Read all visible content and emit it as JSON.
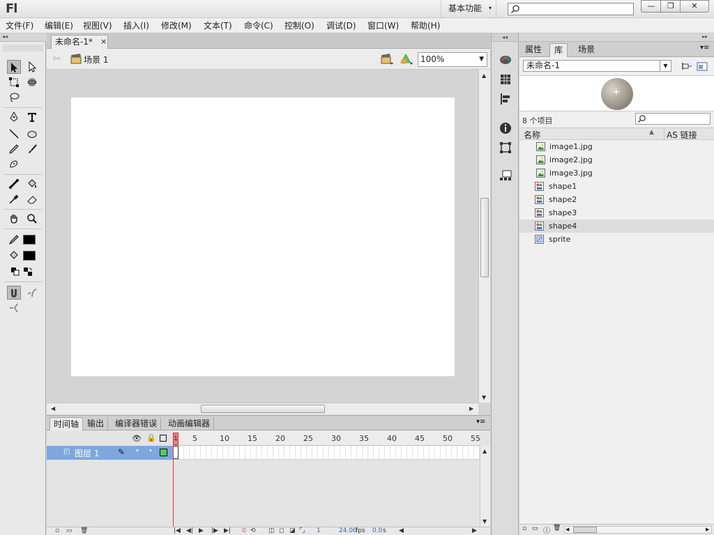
{
  "app": {
    "logo": "Fl"
  },
  "titlebar": {
    "workspace": "基本功能",
    "min": "—",
    "max": "❐",
    "close": "✕"
  },
  "menu": [
    "文件(F)",
    "编辑(E)",
    "视图(V)",
    "插入(I)",
    "修改(M)",
    "文本(T)",
    "命令(C)",
    "控制(O)",
    "调试(D)",
    "窗口(W)",
    "帮助(H)"
  ],
  "document": {
    "tab_title": "未命名-1*",
    "tab_close": "×",
    "scene_label": "场景 1",
    "zoom": "100%"
  },
  "colors": {
    "stroke": "#000000",
    "fill": "#000000",
    "stage": "#ffffff",
    "layer_selected": "#7da7de"
  },
  "timeline": {
    "tabs": [
      "时间轴",
      "输出",
      "编译器错误",
      "动画编辑器"
    ],
    "frame_numbers": [
      "1",
      "5",
      "10",
      "15",
      "20",
      "25",
      "30",
      "35",
      "40",
      "45",
      "50",
      "55"
    ],
    "layer_name": "图层 1",
    "current_frame": "1",
    "fps": "24.00",
    "fps_unit": "fps",
    "time": "0.0",
    "time_unit": "s"
  },
  "library": {
    "tabs": [
      "属性",
      "库",
      "场景"
    ],
    "document": "未命名-1",
    "item_count": "8 个项目",
    "col_name": "名称",
    "col_link": "AS 链接",
    "items": [
      {
        "name": "image1.jpg",
        "type": "bitmap"
      },
      {
        "name": "image2.jpg",
        "type": "bitmap"
      },
      {
        "name": "image3.jpg",
        "type": "bitmap"
      },
      {
        "name": "shape1",
        "type": "graphic"
      },
      {
        "name": "shape2",
        "type": "graphic"
      },
      {
        "name": "shape3",
        "type": "graphic"
      },
      {
        "name": "shape4",
        "type": "graphic",
        "selected": true
      },
      {
        "name": "sprite",
        "type": "movieclip"
      }
    ]
  }
}
